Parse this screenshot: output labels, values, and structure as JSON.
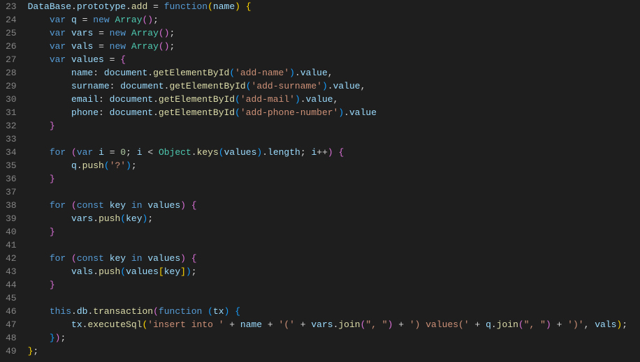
{
  "gutter_start": 23,
  "gutter_end": 49,
  "lines": {
    "l23": [
      {
        "c": "v",
        "t": "DataBase"
      },
      {
        "c": "p",
        "t": "."
      },
      {
        "c": "v",
        "t": "prototype"
      },
      {
        "c": "p",
        "t": "."
      },
      {
        "c": "fn",
        "t": "add"
      },
      {
        "c": "p",
        "t": " = "
      },
      {
        "c": "k",
        "t": "function"
      },
      {
        "c": "c1",
        "t": "("
      },
      {
        "c": "v",
        "t": "name"
      },
      {
        "c": "c1",
        "t": ")"
      },
      {
        "c": "p",
        "t": " "
      },
      {
        "c": "c1",
        "t": "{"
      }
    ],
    "l24": [
      {
        "c": "p",
        "t": "    "
      },
      {
        "c": "k",
        "t": "var"
      },
      {
        "c": "p",
        "t": " "
      },
      {
        "c": "v",
        "t": "q"
      },
      {
        "c": "p",
        "t": " = "
      },
      {
        "c": "k",
        "t": "new"
      },
      {
        "c": "p",
        "t": " "
      },
      {
        "c": "cls",
        "t": "Array"
      },
      {
        "c": "c2",
        "t": "()"
      },
      {
        "c": "p",
        "t": ";"
      }
    ],
    "l25": [
      {
        "c": "p",
        "t": "    "
      },
      {
        "c": "k",
        "t": "var"
      },
      {
        "c": "p",
        "t": " "
      },
      {
        "c": "v",
        "t": "vars"
      },
      {
        "c": "p",
        "t": " = "
      },
      {
        "c": "k",
        "t": "new"
      },
      {
        "c": "p",
        "t": " "
      },
      {
        "c": "cls",
        "t": "Array"
      },
      {
        "c": "c2",
        "t": "()"
      },
      {
        "c": "p",
        "t": ";"
      }
    ],
    "l26": [
      {
        "c": "p",
        "t": "    "
      },
      {
        "c": "k",
        "t": "var"
      },
      {
        "c": "p",
        "t": " "
      },
      {
        "c": "v",
        "t": "vals"
      },
      {
        "c": "p",
        "t": " = "
      },
      {
        "c": "k",
        "t": "new"
      },
      {
        "c": "p",
        "t": " "
      },
      {
        "c": "cls",
        "t": "Array"
      },
      {
        "c": "c2",
        "t": "()"
      },
      {
        "c": "p",
        "t": ";"
      }
    ],
    "l27": [
      {
        "c": "p",
        "t": "    "
      },
      {
        "c": "k",
        "t": "var"
      },
      {
        "c": "p",
        "t": " "
      },
      {
        "c": "v",
        "t": "values"
      },
      {
        "c": "p",
        "t": " = "
      },
      {
        "c": "c2",
        "t": "{"
      }
    ],
    "l28": [
      {
        "c": "p",
        "t": "        "
      },
      {
        "c": "v",
        "t": "name"
      },
      {
        "c": "p",
        "t": ": "
      },
      {
        "c": "v",
        "t": "document"
      },
      {
        "c": "p",
        "t": "."
      },
      {
        "c": "fn",
        "t": "getElementById"
      },
      {
        "c": "c3",
        "t": "("
      },
      {
        "c": "s",
        "t": "'add-name'"
      },
      {
        "c": "c3",
        "t": ")"
      },
      {
        "c": "p",
        "t": "."
      },
      {
        "c": "v",
        "t": "value"
      },
      {
        "c": "p",
        "t": ","
      }
    ],
    "l29": [
      {
        "c": "p",
        "t": "        "
      },
      {
        "c": "v",
        "t": "surname"
      },
      {
        "c": "p",
        "t": ": "
      },
      {
        "c": "v",
        "t": "document"
      },
      {
        "c": "p",
        "t": "."
      },
      {
        "c": "fn",
        "t": "getElementById"
      },
      {
        "c": "c3",
        "t": "("
      },
      {
        "c": "s",
        "t": "'add-surname'"
      },
      {
        "c": "c3",
        "t": ")"
      },
      {
        "c": "p",
        "t": "."
      },
      {
        "c": "v",
        "t": "value"
      },
      {
        "c": "p",
        "t": ","
      }
    ],
    "l30": [
      {
        "c": "p",
        "t": "        "
      },
      {
        "c": "v",
        "t": "email"
      },
      {
        "c": "p",
        "t": ": "
      },
      {
        "c": "v",
        "t": "document"
      },
      {
        "c": "p",
        "t": "."
      },
      {
        "c": "fn",
        "t": "getElementById"
      },
      {
        "c": "c3",
        "t": "("
      },
      {
        "c": "s",
        "t": "'add-mail'"
      },
      {
        "c": "c3",
        "t": ")"
      },
      {
        "c": "p",
        "t": "."
      },
      {
        "c": "v",
        "t": "value"
      },
      {
        "c": "p",
        "t": ","
      }
    ],
    "l31": [
      {
        "c": "p",
        "t": "        "
      },
      {
        "c": "v",
        "t": "phone"
      },
      {
        "c": "p",
        "t": ": "
      },
      {
        "c": "v",
        "t": "document"
      },
      {
        "c": "p",
        "t": "."
      },
      {
        "c": "fn",
        "t": "getElementById"
      },
      {
        "c": "c3",
        "t": "("
      },
      {
        "c": "s",
        "t": "'add-phone-number'"
      },
      {
        "c": "c3",
        "t": ")"
      },
      {
        "c": "p",
        "t": "."
      },
      {
        "c": "v",
        "t": "value"
      }
    ],
    "l32": [
      {
        "c": "p",
        "t": "    "
      },
      {
        "c": "c2",
        "t": "}"
      }
    ],
    "l33": [
      {
        "c": "p",
        "t": ""
      }
    ],
    "l34": [
      {
        "c": "p",
        "t": "    "
      },
      {
        "c": "k",
        "t": "for"
      },
      {
        "c": "p",
        "t": " "
      },
      {
        "c": "c2",
        "t": "("
      },
      {
        "c": "k",
        "t": "var"
      },
      {
        "c": "p",
        "t": " "
      },
      {
        "c": "v",
        "t": "i"
      },
      {
        "c": "p",
        "t": " = "
      },
      {
        "c": "n",
        "t": "0"
      },
      {
        "c": "p",
        "t": "; "
      },
      {
        "c": "v",
        "t": "i"
      },
      {
        "c": "p",
        "t": " < "
      },
      {
        "c": "cls",
        "t": "Object"
      },
      {
        "c": "p",
        "t": "."
      },
      {
        "c": "fn",
        "t": "keys"
      },
      {
        "c": "c3",
        "t": "("
      },
      {
        "c": "v",
        "t": "values"
      },
      {
        "c": "c3",
        "t": ")"
      },
      {
        "c": "p",
        "t": "."
      },
      {
        "c": "v",
        "t": "length"
      },
      {
        "c": "p",
        "t": "; "
      },
      {
        "c": "v",
        "t": "i"
      },
      {
        "c": "p",
        "t": "++"
      },
      {
        "c": "c2",
        "t": ")"
      },
      {
        "c": "p",
        "t": " "
      },
      {
        "c": "c2",
        "t": "{"
      }
    ],
    "l35": [
      {
        "c": "p",
        "t": "        "
      },
      {
        "c": "v",
        "t": "q"
      },
      {
        "c": "p",
        "t": "."
      },
      {
        "c": "fn",
        "t": "push"
      },
      {
        "c": "c3",
        "t": "("
      },
      {
        "c": "s",
        "t": "'?'"
      },
      {
        "c": "c3",
        "t": ")"
      },
      {
        "c": "p",
        "t": ";"
      }
    ],
    "l36": [
      {
        "c": "p",
        "t": "    "
      },
      {
        "c": "c2",
        "t": "}"
      }
    ],
    "l37": [
      {
        "c": "p",
        "t": ""
      }
    ],
    "l38": [
      {
        "c": "p",
        "t": "    "
      },
      {
        "c": "k",
        "t": "for"
      },
      {
        "c": "p",
        "t": " "
      },
      {
        "c": "c2",
        "t": "("
      },
      {
        "c": "k",
        "t": "const"
      },
      {
        "c": "p",
        "t": " "
      },
      {
        "c": "v",
        "t": "key"
      },
      {
        "c": "p",
        "t": " "
      },
      {
        "c": "k",
        "t": "in"
      },
      {
        "c": "p",
        "t": " "
      },
      {
        "c": "v",
        "t": "values"
      },
      {
        "c": "c2",
        "t": ")"
      },
      {
        "c": "p",
        "t": " "
      },
      {
        "c": "c2",
        "t": "{"
      }
    ],
    "l39": [
      {
        "c": "p",
        "t": "        "
      },
      {
        "c": "v",
        "t": "vars"
      },
      {
        "c": "p",
        "t": "."
      },
      {
        "c": "fn",
        "t": "push"
      },
      {
        "c": "c3",
        "t": "("
      },
      {
        "c": "v",
        "t": "key"
      },
      {
        "c": "c3",
        "t": ")"
      },
      {
        "c": "p",
        "t": ";"
      }
    ],
    "l40": [
      {
        "c": "p",
        "t": "    "
      },
      {
        "c": "c2",
        "t": "}"
      }
    ],
    "l41": [
      {
        "c": "p",
        "t": ""
      }
    ],
    "l42": [
      {
        "c": "p",
        "t": "    "
      },
      {
        "c": "k",
        "t": "for"
      },
      {
        "c": "p",
        "t": " "
      },
      {
        "c": "c2",
        "t": "("
      },
      {
        "c": "k",
        "t": "const"
      },
      {
        "c": "p",
        "t": " "
      },
      {
        "c": "v",
        "t": "key"
      },
      {
        "c": "p",
        "t": " "
      },
      {
        "c": "k",
        "t": "in"
      },
      {
        "c": "p",
        "t": " "
      },
      {
        "c": "v",
        "t": "values"
      },
      {
        "c": "c2",
        "t": ")"
      },
      {
        "c": "p",
        "t": " "
      },
      {
        "c": "c2",
        "t": "{"
      }
    ],
    "l43": [
      {
        "c": "p",
        "t": "        "
      },
      {
        "c": "v",
        "t": "vals"
      },
      {
        "c": "p",
        "t": "."
      },
      {
        "c": "fn",
        "t": "push"
      },
      {
        "c": "c3",
        "t": "("
      },
      {
        "c": "v",
        "t": "values"
      },
      {
        "c": "c4",
        "t": "["
      },
      {
        "c": "v",
        "t": "key"
      },
      {
        "c": "c4",
        "t": "]"
      },
      {
        "c": "c3",
        "t": ")"
      },
      {
        "c": "p",
        "t": ";"
      }
    ],
    "l44": [
      {
        "c": "p",
        "t": "    "
      },
      {
        "c": "c2",
        "t": "}"
      }
    ],
    "l45": [
      {
        "c": "p",
        "t": ""
      }
    ],
    "l46": [
      {
        "c": "p",
        "t": "    "
      },
      {
        "c": "k",
        "t": "this"
      },
      {
        "c": "p",
        "t": "."
      },
      {
        "c": "v",
        "t": "db"
      },
      {
        "c": "p",
        "t": "."
      },
      {
        "c": "fn",
        "t": "transaction"
      },
      {
        "c": "c2",
        "t": "("
      },
      {
        "c": "k",
        "t": "function"
      },
      {
        "c": "p",
        "t": " "
      },
      {
        "c": "c3",
        "t": "("
      },
      {
        "c": "v",
        "t": "tx"
      },
      {
        "c": "c3",
        "t": ")"
      },
      {
        "c": "p",
        "t": " "
      },
      {
        "c": "c3",
        "t": "{"
      }
    ],
    "l47": [
      {
        "c": "p",
        "t": "        "
      },
      {
        "c": "v",
        "t": "tx"
      },
      {
        "c": "p",
        "t": "."
      },
      {
        "c": "fn",
        "t": "executeSql"
      },
      {
        "c": "c4",
        "t": "("
      },
      {
        "c": "s",
        "t": "'insert into '"
      },
      {
        "c": "p",
        "t": " + "
      },
      {
        "c": "v",
        "t": "name"
      },
      {
        "c": "p",
        "t": " + "
      },
      {
        "c": "s",
        "t": "'('"
      },
      {
        "c": "p",
        "t": " + "
      },
      {
        "c": "v",
        "t": "vars"
      },
      {
        "c": "p",
        "t": "."
      },
      {
        "c": "fn",
        "t": "join"
      },
      {
        "c": "c2",
        "t": "("
      },
      {
        "c": "s",
        "t": "\", \""
      },
      {
        "c": "c2",
        "t": ")"
      },
      {
        "c": "p",
        "t": " + "
      },
      {
        "c": "s",
        "t": "') values('"
      },
      {
        "c": "p",
        "t": " + "
      },
      {
        "c": "v",
        "t": "q"
      },
      {
        "c": "p",
        "t": "."
      },
      {
        "c": "fn",
        "t": "join"
      },
      {
        "c": "c2",
        "t": "("
      },
      {
        "c": "s",
        "t": "\", \""
      },
      {
        "c": "c2",
        "t": ")"
      },
      {
        "c": "p",
        "t": " + "
      },
      {
        "c": "s",
        "t": "')'"
      },
      {
        "c": "p",
        "t": ", "
      },
      {
        "c": "v",
        "t": "vals"
      },
      {
        "c": "c4",
        "t": ")"
      },
      {
        "c": "p",
        "t": ";"
      }
    ],
    "l48": [
      {
        "c": "p",
        "t": "    "
      },
      {
        "c": "c3",
        "t": "}"
      },
      {
        "c": "c2",
        "t": ")"
      },
      {
        "c": "p",
        "t": ";"
      }
    ],
    "l49": [
      {
        "c": "c1",
        "t": "}"
      },
      {
        "c": "p",
        "t": ";"
      }
    ]
  }
}
